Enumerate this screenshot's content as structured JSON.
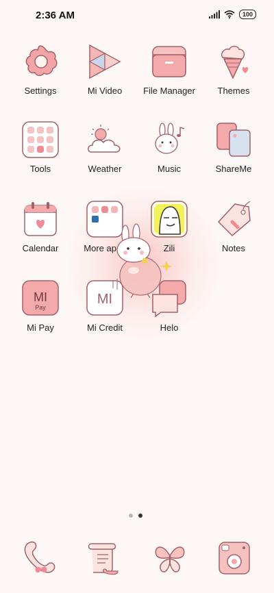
{
  "status": {
    "time": "2:36 AM",
    "battery": "100"
  },
  "apps": [
    {
      "label": "Settings",
      "icon": "settings-flower-icon"
    },
    {
      "label": "Mi Video",
      "icon": "mi-video-icon"
    },
    {
      "label": "File Manager",
      "icon": "folder-icon"
    },
    {
      "label": "Themes",
      "icon": "ice-cream-icon"
    },
    {
      "label": "Tools",
      "icon": "tools-folder-icon"
    },
    {
      "label": "Weather",
      "icon": "weather-icon"
    },
    {
      "label": "Music",
      "icon": "bunny-music-icon"
    },
    {
      "label": "ShareMe",
      "icon": "shareme-icon"
    },
    {
      "label": "Calendar",
      "icon": "calendar-icon"
    },
    {
      "label": "More apps",
      "icon": "more-apps-folder-icon"
    },
    {
      "label": "Zili",
      "icon": "zili-icon"
    },
    {
      "label": "Notes",
      "icon": "notes-tag-icon"
    },
    {
      "label": "Mi Pay",
      "icon": "mi-pay-icon"
    },
    {
      "label": "Mi Credit",
      "icon": "mi-credit-icon"
    },
    {
      "label": "Helo",
      "icon": "helo-icon"
    }
  ],
  "mi_pay_text": "MI",
  "mi_pay_sub": "Pay",
  "mi_credit_text": "MI",
  "page_indicator": {
    "pages": 2,
    "current": 2
  },
  "dock": [
    {
      "icon": "phone-icon"
    },
    {
      "icon": "scroll-messages-icon"
    },
    {
      "icon": "butterfly-browser-icon"
    },
    {
      "icon": "camera-icon"
    }
  ]
}
